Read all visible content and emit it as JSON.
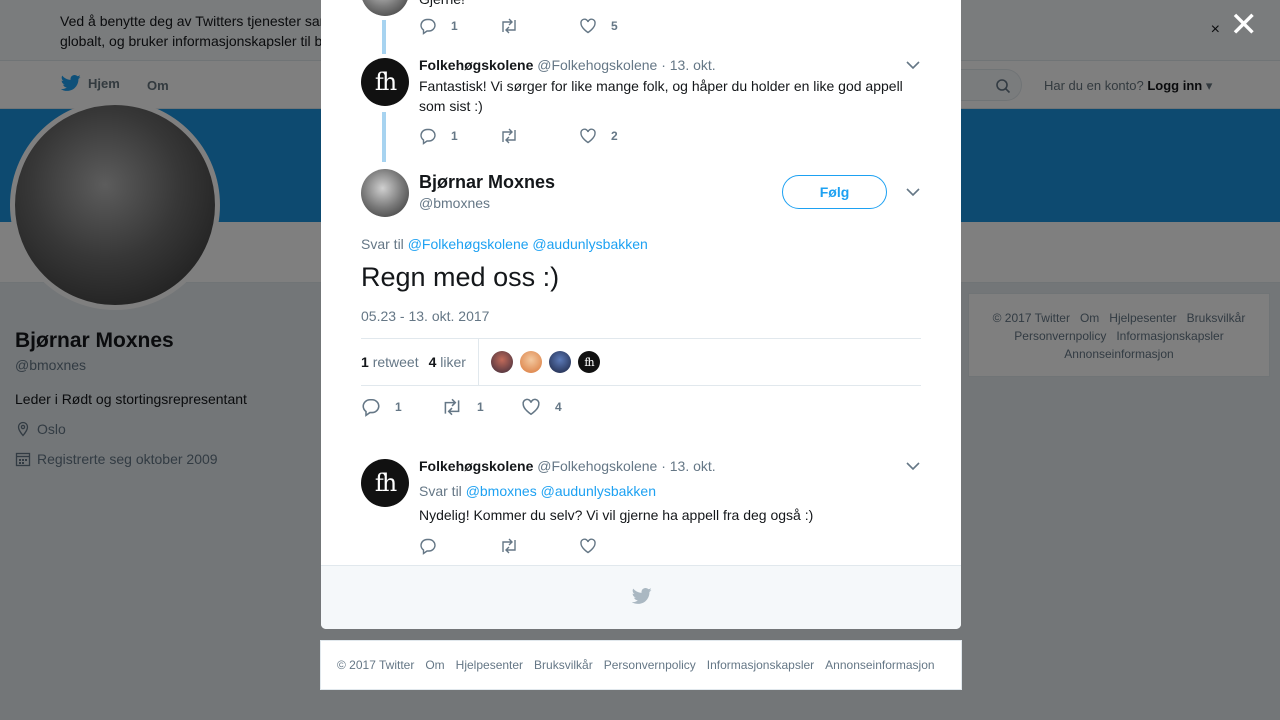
{
  "cookie_bar": {
    "text_line1": "Ved å benytte deg av Twitters tjenester samtykker du i vår bruk av informasjonskapsler. Twitter og våre samarbeidspartnere opererer",
    "text_line2": "globalt, og bruker informasjonskapsler til blant annet analyse, personalisering og annonser.",
    "close_label": "×"
  },
  "topnav": {
    "home_label": "Hjem",
    "about_label": "Om",
    "account_prompt": "Har du en konto?",
    "login_label": "Logg inn"
  },
  "profile": {
    "name": "Bjørnar Moxnes",
    "handle": "@bmoxnes",
    "bio": "Leder i Rødt og stortingsrepresentant",
    "location": "Oslo",
    "joined": "Registrerte seg oktober 2009"
  },
  "side_footer": {
    "links": [
      "© 2017 Twitter",
      "Om",
      "Hjelpesenter",
      "Bruksvilkår",
      "Personvernpolicy",
      "Informasjonskapsler",
      "Annonseinformasjon"
    ]
  },
  "overlay": {
    "close_label": "✕"
  },
  "modal": {
    "top_tweet": {
      "text_fragment": "Gjerne!",
      "replies": "1",
      "retweets": "",
      "likes": "5"
    },
    "reply1": {
      "name": "Folkehøgskolene",
      "handle": "@Folkehogskolene",
      "date": "· 13. okt.",
      "text": "Fantastisk! Vi sørger for like mange folk, og håper du holder en like god appell som sist :)",
      "replies": "1",
      "retweets": "",
      "likes": "2"
    },
    "main_tweet": {
      "name": "Bjørnar Moxnes",
      "handle": "@bmoxnes",
      "follow_label": "Følg",
      "reply_prefix": "Svar til",
      "reply_mention1": "@Folkehøgskolene",
      "reply_mention2": "@audunlysbakken",
      "text": "Regn med oss :)",
      "timestamp": "05.23 - 13. okt. 2017",
      "retweet_count": "1",
      "retweet_label": "retweet",
      "like_count": "4",
      "like_label": "liker",
      "replies": "1",
      "retweets": "1",
      "likes": "4"
    },
    "reply2": {
      "name": "Folkehøgskolene",
      "handle": "@Folkehogskolene",
      "date": "· 13. okt.",
      "reply_prefix": "Svar til",
      "reply_mention1": "@bmoxnes",
      "reply_mention2": "@audunlysbakken",
      "text": "Nydelig! Kommer du selv? Vi vil gjerne ha appell fra deg også :)"
    },
    "fh_logo": "fh"
  },
  "page_footer": {
    "links": [
      "© 2017 Twitter",
      "Om",
      "Hjelpesenter",
      "Bruksvilkår",
      "Personvernpolicy",
      "Informasjonskapsler",
      "Annonseinformasjon"
    ]
  },
  "colors": {
    "accent": "#1da1f2",
    "banner": "#1b95e0",
    "thread_line": "#a7d3f0"
  }
}
